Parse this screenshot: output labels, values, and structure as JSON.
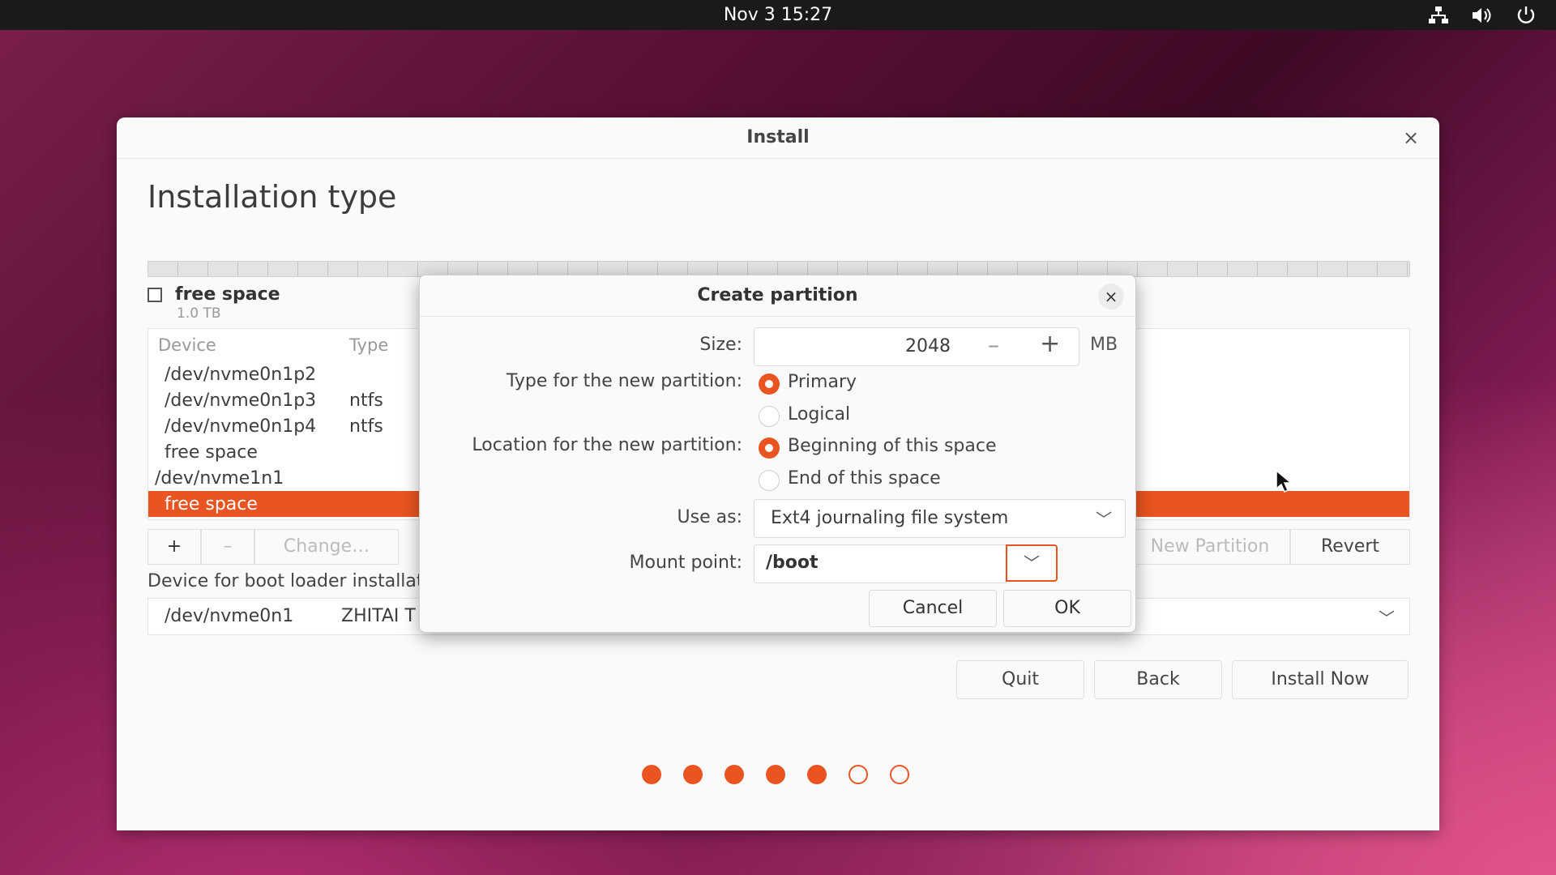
{
  "topbar": {
    "clock": "Nov 3  15:27",
    "tray_icons": [
      "network-icon",
      "volume-icon",
      "power-icon"
    ]
  },
  "window": {
    "title": "Install",
    "close": "×",
    "heading": "Installation type"
  },
  "disk_legend": {
    "label": "free space",
    "size": "1.0 TB"
  },
  "partition_table": {
    "headers": {
      "device": "Device",
      "type": "Type"
    },
    "rows": [
      {
        "device": "/dev/nvme0n1p2",
        "type": ""
      },
      {
        "device": "/dev/nvme0n1p3",
        "type": "ntfs"
      },
      {
        "device": "/dev/nvme0n1p4",
        "type": "ntfs"
      },
      {
        "device": "free space",
        "type": ""
      },
      {
        "device": "/dev/nvme1n1",
        "type": ""
      },
      {
        "device": "free space",
        "type": "",
        "selected": true
      }
    ]
  },
  "table_buttons": {
    "add": "+",
    "remove": "–",
    "change": "Change…",
    "new_table": "New Partition Table…",
    "revert": "Revert"
  },
  "boot_loader": {
    "label": "Device for boot loader installation:",
    "device": "/dev/nvme0n1",
    "model": "ZHITAI T"
  },
  "nav": {
    "quit": "Quit",
    "back": "Back",
    "install": "Install Now"
  },
  "progress": {
    "completed_steps": 5,
    "total_steps": 7
  },
  "dialog": {
    "title": "Create partition",
    "close": "×",
    "size_label": "Size:",
    "size_value": "2048",
    "size_minus": "–",
    "size_plus": "+",
    "size_unit": "MB",
    "type_label": "Type for the new partition:",
    "type_options": [
      "Primary",
      "Logical"
    ],
    "type_selected": "Primary",
    "location_label": "Location for the new partition:",
    "location_options": [
      "Beginning of this space",
      "End of this space"
    ],
    "location_selected": "Beginning of this space",
    "use_as_label": "Use as:",
    "use_as_value": "Ext4 journaling file system",
    "mount_label": "Mount point:",
    "mount_value": "/boot",
    "cancel": "Cancel",
    "ok": "OK"
  },
  "colors": {
    "accent": "#e95420",
    "topbar": "#1a1a1a",
    "window_bg": "#fafafa"
  }
}
